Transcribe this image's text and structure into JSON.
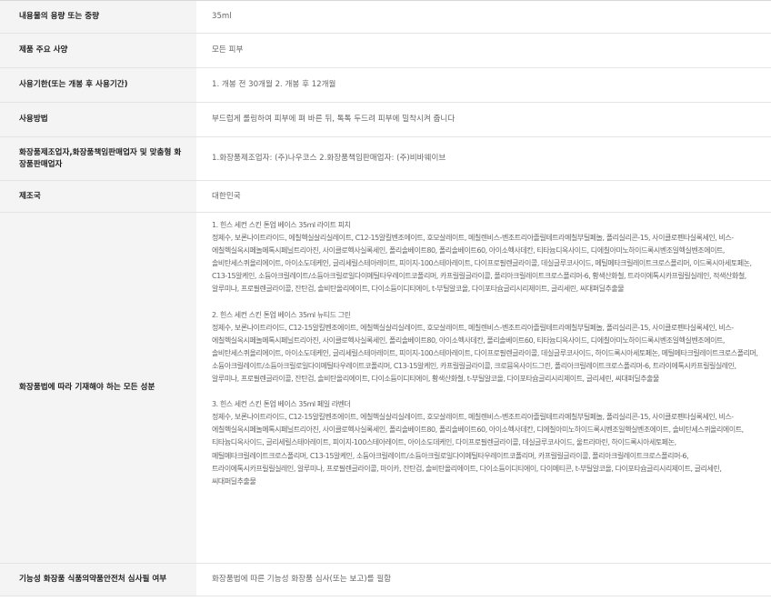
{
  "rows": [
    {
      "label": "내용물의 용량 또는 중량",
      "value": "35ml"
    },
    {
      "label": "제품 주요 사양",
      "value": "모든 피부"
    },
    {
      "label": "사용기한(또는 개봉 후 사용기간)",
      "value": "1. 개봉 전 30개월 2. 개봉 후 12개월"
    },
    {
      "label": "사용방법",
      "value": "부드럽게 롤링하여 피부에 펴 바른 뒤, 톡톡 두드려 피부에 밀착시켜 줍니다"
    },
    {
      "label": "화장품제조업자,화장품책임판매업자 및 맞춤형 화장품판매업자",
      "value": "1.화장품제조업자: (주)나우코스 2.화장품책임판매업자: (주)비바웨이브"
    },
    {
      "label": "제조국",
      "value": "대한민국"
    },
    {
      "label": "화장품법에 따라 기재해야 하는 모든 성분"
    },
    {
      "label": "기능성 화장품 식품의약품안전처 심사필 여부",
      "value": "화장품법에 따른 기능성 화장품 심사(또는 보고)를 필함"
    }
  ],
  "ingredients": [
    {
      "title": "1. 힌스 세컨 스킨 톤업 베이스 35ml 라이트 피치",
      "list": "정제수, 보론나이트라이드, 에칠헥실살리실레이트, C12-15알킬벤조에이트, 호모살레이트, 메칠렌비스-벤조트리아졸릴테트라메칠부틸페놀, 폴리실리콘-15, 사이클로펜타실록세인, 비스-에칠헥실옥시페놀메톡시페닐트리아진, 사이클로헥사실록세인, 폴리솔베이트80, 폴리솔베이트60, 아이소헥사데칸, 티타늄디옥사이드, 디에칠아미노하이드록시벤조일헥실벤조에이트, 솔비탄세스퀴올리에이트, 아이소도데케인, 글리세릴스테아레이트, 피이지-100스테아레이트, 다이프로필렌글라이콜, 데실글루코사이드, 메틸메타크릴레이트크로스폴리머, 이드록시아세토페논, C13-15알케인, 소듐아크릴레이트/소듐아크릴로일다이메틸타우레이트코폴리머, 카프릴릴글라이콜, 폴리아크릴레이트크로스폴리머-6, 황색산화철, 트라이에톡시카프릴릴실레인, 적색산화철, 알루미나, 프로필렌글라이콜, 잔탄검, 솔비탄올리에이트, 다이소듐이디티에이, t-부틸알코올, 다이포타슘글리시리제이트, 글리세린, 씨대퍼딜추출물"
    },
    {
      "title": "2. 힌스 세컨 스킨 톤업 베이스 35ml 뉴티드 그린",
      "list": "정제수, 보론나이트라이드, C12-15알킬벤조에이트, 에칠헥실살리실레이트, 호모살레이트, 메칠렌비스-벤조트리아졸릴테트라메칠부틸페놀, 폴리실리콘-15, 사이클로펜타실록세인, 비스-에칠헥실옥시페놀메톡시페닐트리아진, 사이클로헥사실록세인, 폴리솔베이트80, 아이소헥사데칸, 폴리솔베이트60, 티타늄디옥사이드, 디에칠아미노하이드록시벤조일헥실벤조에이트, 솔비탄세스퀴올리에이트, 아이소도데케인, 글리세릴스테아레이트, 피이지-100스테아레이트, 다이프로필렌글라이콜, 데실글루코사이드, 하이드록시아세토페논, 메틸메타크릴레이트크로스폴리머, 소듐아크릴레이트/소듐아크릴로일다이메틸타우레이트코폴리머, C13-15알케인, 카프릴릴글라이콜, 크로뮴옥사이드그린, 폴리아크릴레이트크로스폴리머-6, 트라이에톡시카프릴릴실레인, 알루미나, 프로필렌글라이콜, 잔탄검, 솔비탄올리에이트, 다이소듐이디티에이, 황색산화철, t-부틸알코올, 다이포타슘글리시리제이트, 글리세린, 씨대퍼딜추출물"
    },
    {
      "title": "3. 힌스 세컨 스킨 톤업 베이스 35ml 페일 라벤더",
      "list": "정제수, 보론나이트라이드, C12-15알킬벤조에이트, 에칠헥실살리실레이트, 호모살레이트, 메칠렌비스-벤조트리아졸릴테트라메칠부틸페놀, 폴리실리콘-15, 사이클로펜타실록세인, 비스-에칠헥실옥시페놀메톡시페닐트리아진, 사이클로헥사실록세인, 폴리솔베이트80, 폴리솔베이트60, 아이소헥사데칸, 디에칠아미노하이드록시벤조일헥실벤조에이트, 솔비탄세스퀴올리에이트, 티타늄디옥사이드, 글리세릴스테아레이트, 피이지-100스테아레이트, 아이소도데케인, 다이프로필렌글라이콜, 데실글루코사이드, 울트라마린, 하이드록시아세토페논, 메틸메타크릴레이트크로스폴리머, C13-15알케인, 소듐아크릴레이트/소듐아크릴로일다이메틸타우레이트코폴리머, 카프릴릴글라이콜, 폴리아크릴레이트크로스폴리머-6, 트라이에톡시카프릴릴실레인, 알루미나, 프로필렌글라이콜, 마이카, 잔탄검, 솔비탄올리에이트, 다이소듐이디티에이, 다이메티콘, t-부틸알코올, 다이포타슘글리시리제이트, 글리세린, 씨대퍼딜추출물"
    }
  ]
}
